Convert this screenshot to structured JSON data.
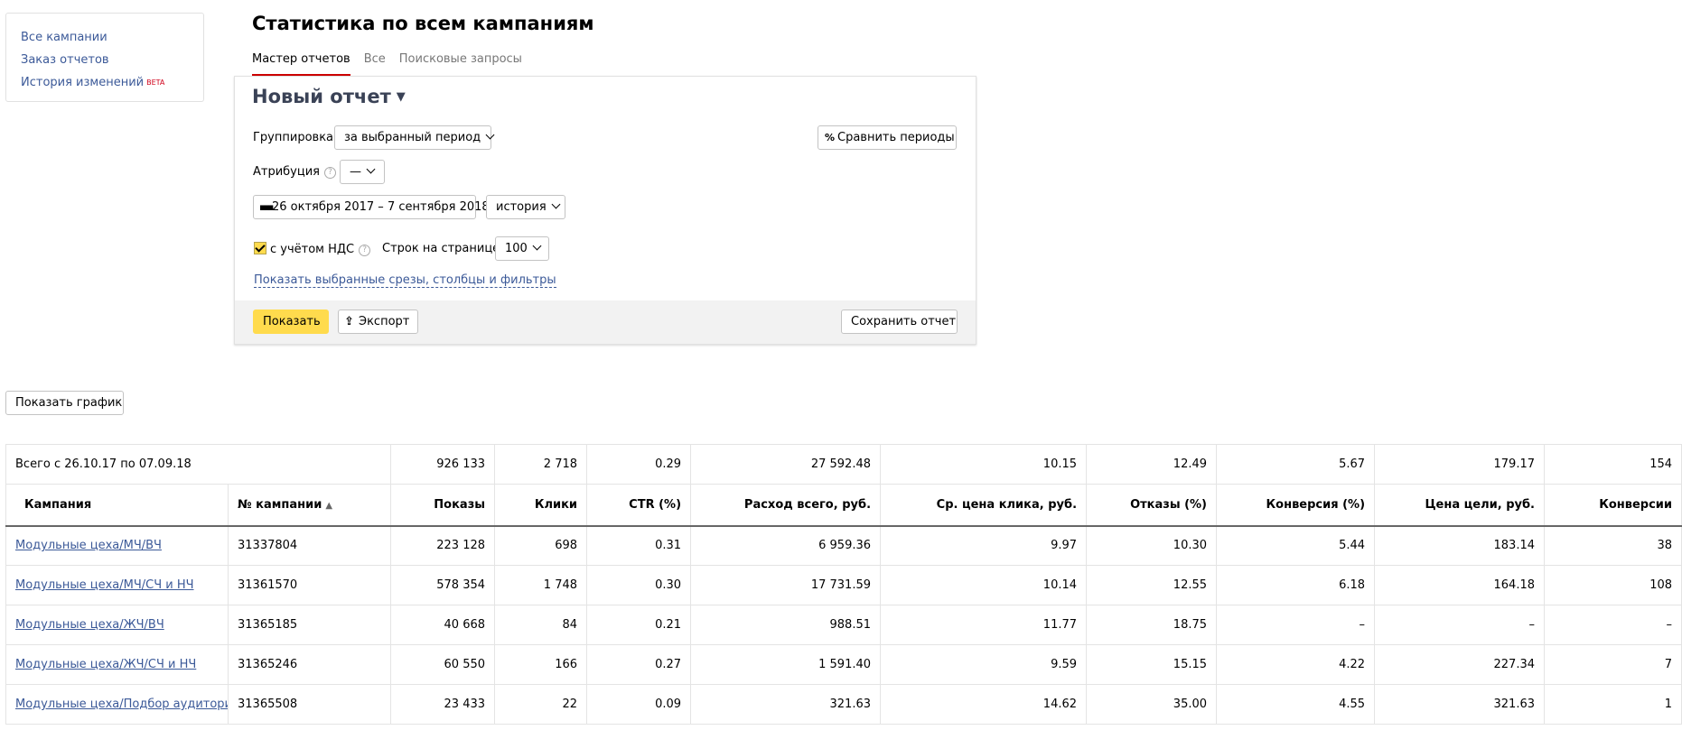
{
  "sidebar": {
    "items": [
      {
        "label": "Все кампании"
      },
      {
        "label": "Заказ отчетов"
      },
      {
        "label": "История изменений",
        "badge": "BETA"
      }
    ]
  },
  "page_title": "Статистика по всем кампаниям",
  "tabs": [
    {
      "label": "Мастер отчетов",
      "active": true
    },
    {
      "label": "Все",
      "active": false
    },
    {
      "label": "Поисковые запросы",
      "active": false
    }
  ],
  "report": {
    "title": "Новый отчет",
    "grouping_label": "Группировка",
    "grouping_value": "за выбранный период",
    "compare_label": "Сравнить периоды",
    "attribution_label": "Атрибуция",
    "attribution_value": "—",
    "date_range": "26 октября 2017 – 7 сентября 2018",
    "history_value": "история",
    "vat_label": "с учётом НДС",
    "vat_checked": true,
    "rows_label": "Строк на странице",
    "rows_value": "100",
    "show_selected_link": "Показать выбранные срезы, столбцы и фильтры",
    "show_button": "Показать",
    "export_button": "Экспорт",
    "save_button": "Сохранить отчет"
  },
  "show_chart_button": "Показать график",
  "table": {
    "total": {
      "label": "Всего с 26.10.17 по 07.09.18",
      "values": [
        "926 133",
        "2 718",
        "0.29",
        "27 592.48",
        "10.15",
        "12.49",
        "5.67",
        "179.17",
        "154"
      ]
    },
    "headers": [
      "Кампания",
      "№ кампании",
      "Показы",
      "Клики",
      "CTR (%)",
      "Расход всего, руб.",
      "Ср. цена клика, руб.",
      "Отказы (%)",
      "Конверсия (%)",
      "Цена цели, руб.",
      "Конверсии"
    ],
    "rows": [
      {
        "name": "Модульные цеха/МЧ/ВЧ",
        "id": "31337804",
        "values": [
          "223 128",
          "698",
          "0.31",
          "6 959.36",
          "9.97",
          "10.30",
          "5.44",
          "183.14",
          "38"
        ]
      },
      {
        "name": "Модульные цеха/МЧ/СЧ и НЧ",
        "id": "31361570",
        "values": [
          "578 354",
          "1 748",
          "0.30",
          "17 731.59",
          "10.14",
          "12.55",
          "6.18",
          "164.18",
          "108"
        ]
      },
      {
        "name": "Модульные цеха/ЖЧ/ВЧ",
        "id": "31365185",
        "values": [
          "40 668",
          "84",
          "0.21",
          "988.51",
          "11.77",
          "18.75",
          "–",
          "–",
          "–"
        ]
      },
      {
        "name": "Модульные цеха/ЖЧ/СЧ и НЧ",
        "id": "31365246",
        "values": [
          "60 550",
          "166",
          "0.27",
          "1 591.40",
          "9.59",
          "15.15",
          "4.22",
          "227.34",
          "7"
        ]
      },
      {
        "name": "Модульные цеха/Подбор аудитории",
        "id": "31365508",
        "values": [
          "23 433",
          "22",
          "0.09",
          "321.63",
          "14.62",
          "35.00",
          "4.55",
          "321.63",
          "1"
        ]
      }
    ]
  }
}
